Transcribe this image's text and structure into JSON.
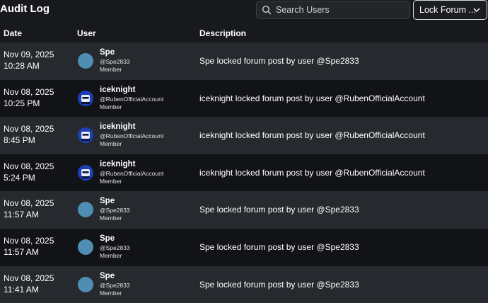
{
  "header": {
    "title": "Audit Log",
    "search_placeholder": "Search Users",
    "action_filter": "Lock Forum ..."
  },
  "columns": {
    "date": "Date",
    "user": "User",
    "description": "Description"
  },
  "rows": [
    {
      "date": "Nov 09, 2025",
      "time": "10:28 AM",
      "user": "Spe",
      "handle": "@Spe2833",
      "role": "Member",
      "avatar": "plain-avatar",
      "description": "Spe locked forum post by user @Spe2833"
    },
    {
      "date": "Nov 08, 2025",
      "time": "10:25 PM",
      "user": "iceknight",
      "handle": "@RubenOfficialAccount",
      "role": "Member",
      "avatar": "knight-avatar",
      "description": "iceknight locked forum post by user @RubenOfficialAccount"
    },
    {
      "date": "Nov 08, 2025",
      "time": "8:45 PM",
      "user": "iceknight",
      "handle": "@RubenOfficialAccount",
      "role": "Member",
      "avatar": "knight-avatar",
      "description": "iceknight locked forum post by user @RubenOfficialAccount"
    },
    {
      "date": "Nov 08, 2025",
      "time": "5:24 PM",
      "user": "iceknight",
      "handle": "@RubenOfficialAccount",
      "role": "Member",
      "avatar": "knight-avatar",
      "description": "iceknight locked forum post by user @RubenOfficialAccount"
    },
    {
      "date": "Nov 08, 2025",
      "time": "11:57 AM",
      "user": "Spe",
      "handle": "@Spe2833",
      "role": "Member",
      "avatar": "plain-avatar",
      "description": "Spe locked forum post by user @Spe2833"
    },
    {
      "date": "Nov 08, 2025",
      "time": "11:57 AM",
      "user": "Spe",
      "handle": "@Spe2833",
      "role": "Member",
      "avatar": "plain-avatar",
      "description": "Spe locked forum post by user @Spe2833"
    },
    {
      "date": "Nov 08, 2025",
      "time": "11:41 AM",
      "user": "Spe",
      "handle": "@Spe2833",
      "role": "Member",
      "avatar": "plain-avatar",
      "description": "Spe locked forum post by user @Spe2833"
    }
  ]
}
